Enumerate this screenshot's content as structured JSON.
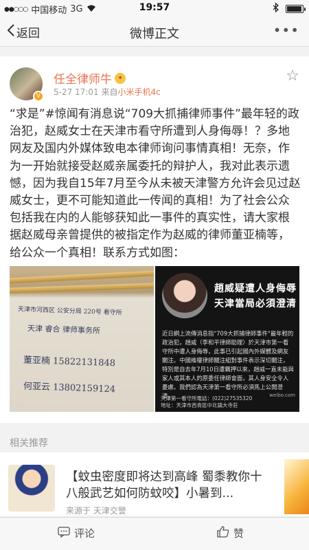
{
  "status_bar": {
    "carrier": "中国移动",
    "network": "3G",
    "time": "19:57",
    "battery_level": 0.95
  },
  "nav": {
    "back_label": "返回",
    "title": "微博正文"
  },
  "post": {
    "author": "任全律师牛",
    "time": "5-27 17:01",
    "source_prefix": "来自",
    "source": "小米手机4c",
    "text": "“求是”#惊闻有消息说“709大抓捕律师事件”最年轻的政治犯，赵威女士在天津市看守所遭到人身侮辱！？多地网友及国内外媒体致电本律师询问事情真相！无奈，作为一开始就接受赵威亲属委托的辩护人，我对此表示遗憾，因为我自15年7月至今从未被天津警方允许会见过赵威女士，更不可能知道此一传闻的真相！为了社会公众包括我在内的人能够获知此一事件的真实性，请大家根据赵威母亲曾提供的被指定作为赵威的律师董亚楠等，给公众一个真相！联系方式如图：",
    "image1": {
      "line1": "天津市河西区 公安分局 220号 看守所",
      "line2": "天津 睿合 律师事务所",
      "line3": "董亚楠  15822131848",
      "line4": "何亚云  13802159124"
    },
    "image2": {
      "headline1": "趙威疑遭人身侮辱",
      "headline2": "天津當局必須澄清",
      "body": "近日網上流傳消息指\"709大抓捕律師事件\"最年輕的政治犯，趙威（李和平律師助理）於天津市第一看守所中遭人身侮辱，此事已引起國內外媒體及網友關注。中國維權律師關注組對事件表示深切關注，特別是自去年7月10日遭羈押以來，趙威一直未能與家人或其本人的原委任律師會面，其人身安全令人憂慮。我們認為天津第一看守所必須馬上公開澄清。",
      "footer_phone": "天津第一看守所電話：(022)27535320",
      "footer_address": "地址：天津市西青區中北鎮大寺莊",
      "watermark": "weibo.com"
    }
  },
  "related": {
    "header": "相关推荐",
    "title": "【蚊虫密度即将达到高峰 蜀黍教你十八般武艺如何防蚊咬】小暑到...",
    "source": "来源于 天津交警"
  },
  "bottom_bar": {
    "comment_label": "评论",
    "like_label": "赞"
  }
}
